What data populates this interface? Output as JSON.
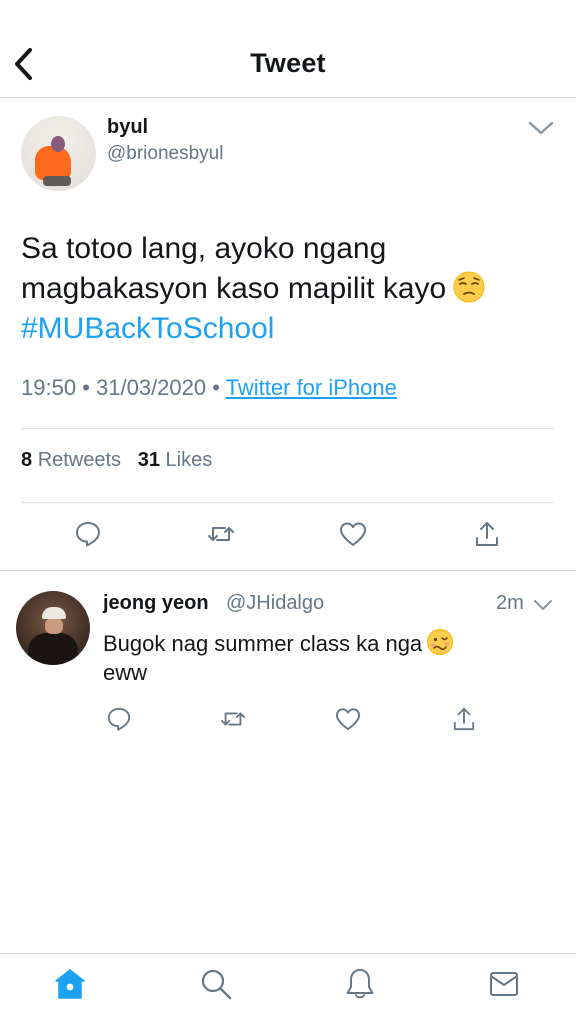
{
  "header": {
    "title": "Tweet"
  },
  "tweet": {
    "name": "byul",
    "handle": "@brionesbyul",
    "text": "Sa totoo lang, ayoko ngang magbakasyon kaso mapilit kayo",
    "emoji": "pensive-face",
    "hashtag": "#MUBackToSchool",
    "time": "19:50",
    "separator": "•",
    "date": "31/03/2020",
    "source": "Twitter for iPhone",
    "retweets_count": "8",
    "retweets_label": "Retweets",
    "likes_count": "31",
    "likes_label": "Likes"
  },
  "reply": {
    "name": "jeong yeon",
    "handle": "@JHidalgo",
    "time": "2m",
    "text": "Bugok nag summer class ka nga",
    "text_end": "eww",
    "emoji": "woozy-face"
  },
  "colors": {
    "accent": "#1da1f2",
    "text": "#14171a",
    "muted": "#657786",
    "divider": "#cfd5da"
  }
}
